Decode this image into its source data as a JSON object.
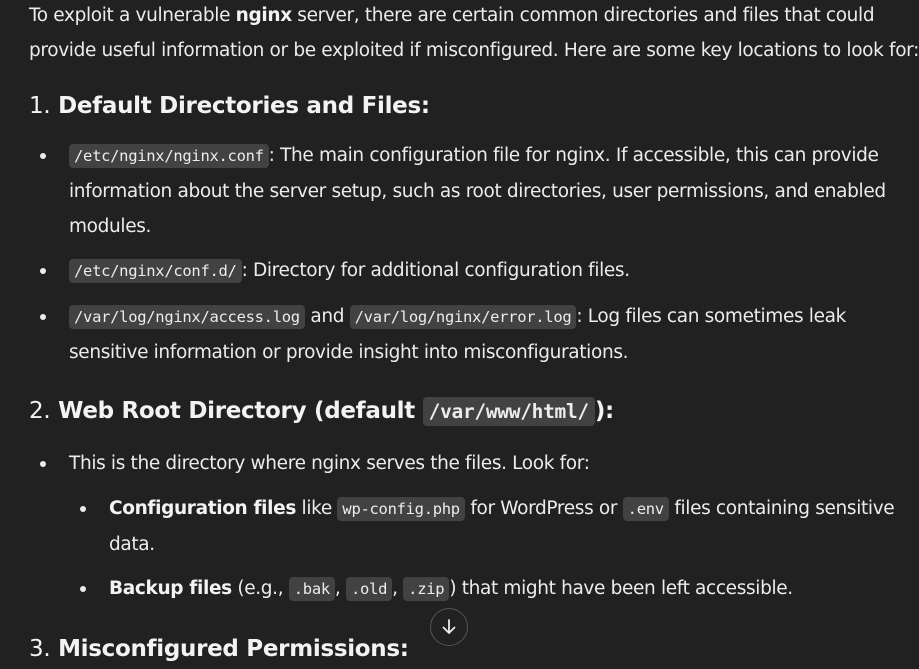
{
  "intro": {
    "text_1": "To exploit a vulnerable ",
    "bold": "nginx",
    "text_2": " server, there are certain common directories and files that could provide useful information or be exploited if misconfigured. Here are some key locations to look for:"
  },
  "section1": {
    "num": "1.",
    "title": "Default Directories and Files:",
    "items": [
      {
        "code": "/etc/nginx/nginx.conf",
        "text": ": The main configuration file for nginx. If accessible, this can provide information about the server setup, such as root directories, user permissions, and enabled modules."
      },
      {
        "code": "/etc/nginx/conf.d/",
        "text": ": Directory for additional configuration files."
      },
      {
        "code": "/var/log/nginx/access.log",
        "mid": " and ",
        "code2": "/var/log/nginx/error.log",
        "text": ": Log files can sometimes leak sensitive information or provide insight into misconfigurations."
      }
    ]
  },
  "section2": {
    "num": "2.",
    "title": "Web Root Directory (default ",
    "code": "/var/www/html/",
    "title_end": "):",
    "item": "This is the directory where nginx serves the files. Look for:",
    "sub_items": [
      {
        "bold": "Configuration files",
        "t1": " like ",
        "code1": "wp-config.php",
        "t2": " for WordPress or ",
        "code2": ".env",
        "t3": " files containing sensitive data."
      },
      {
        "bold": "Backup files",
        "t1": " (e.g., ",
        "code1": ".bak",
        "sep1": ", ",
        "code2": ".old",
        "sep2": ", ",
        "code3": ".zip",
        "t2": ") that might have been left accessible."
      }
    ]
  },
  "section3": {
    "num": "3.",
    "title": "Misconfigured Permissions:"
  },
  "scroll_button": {
    "icon": "arrow-down-icon"
  },
  "colors": {
    "background": "#212121",
    "text": "#ececec",
    "code_bg": "#424242"
  }
}
